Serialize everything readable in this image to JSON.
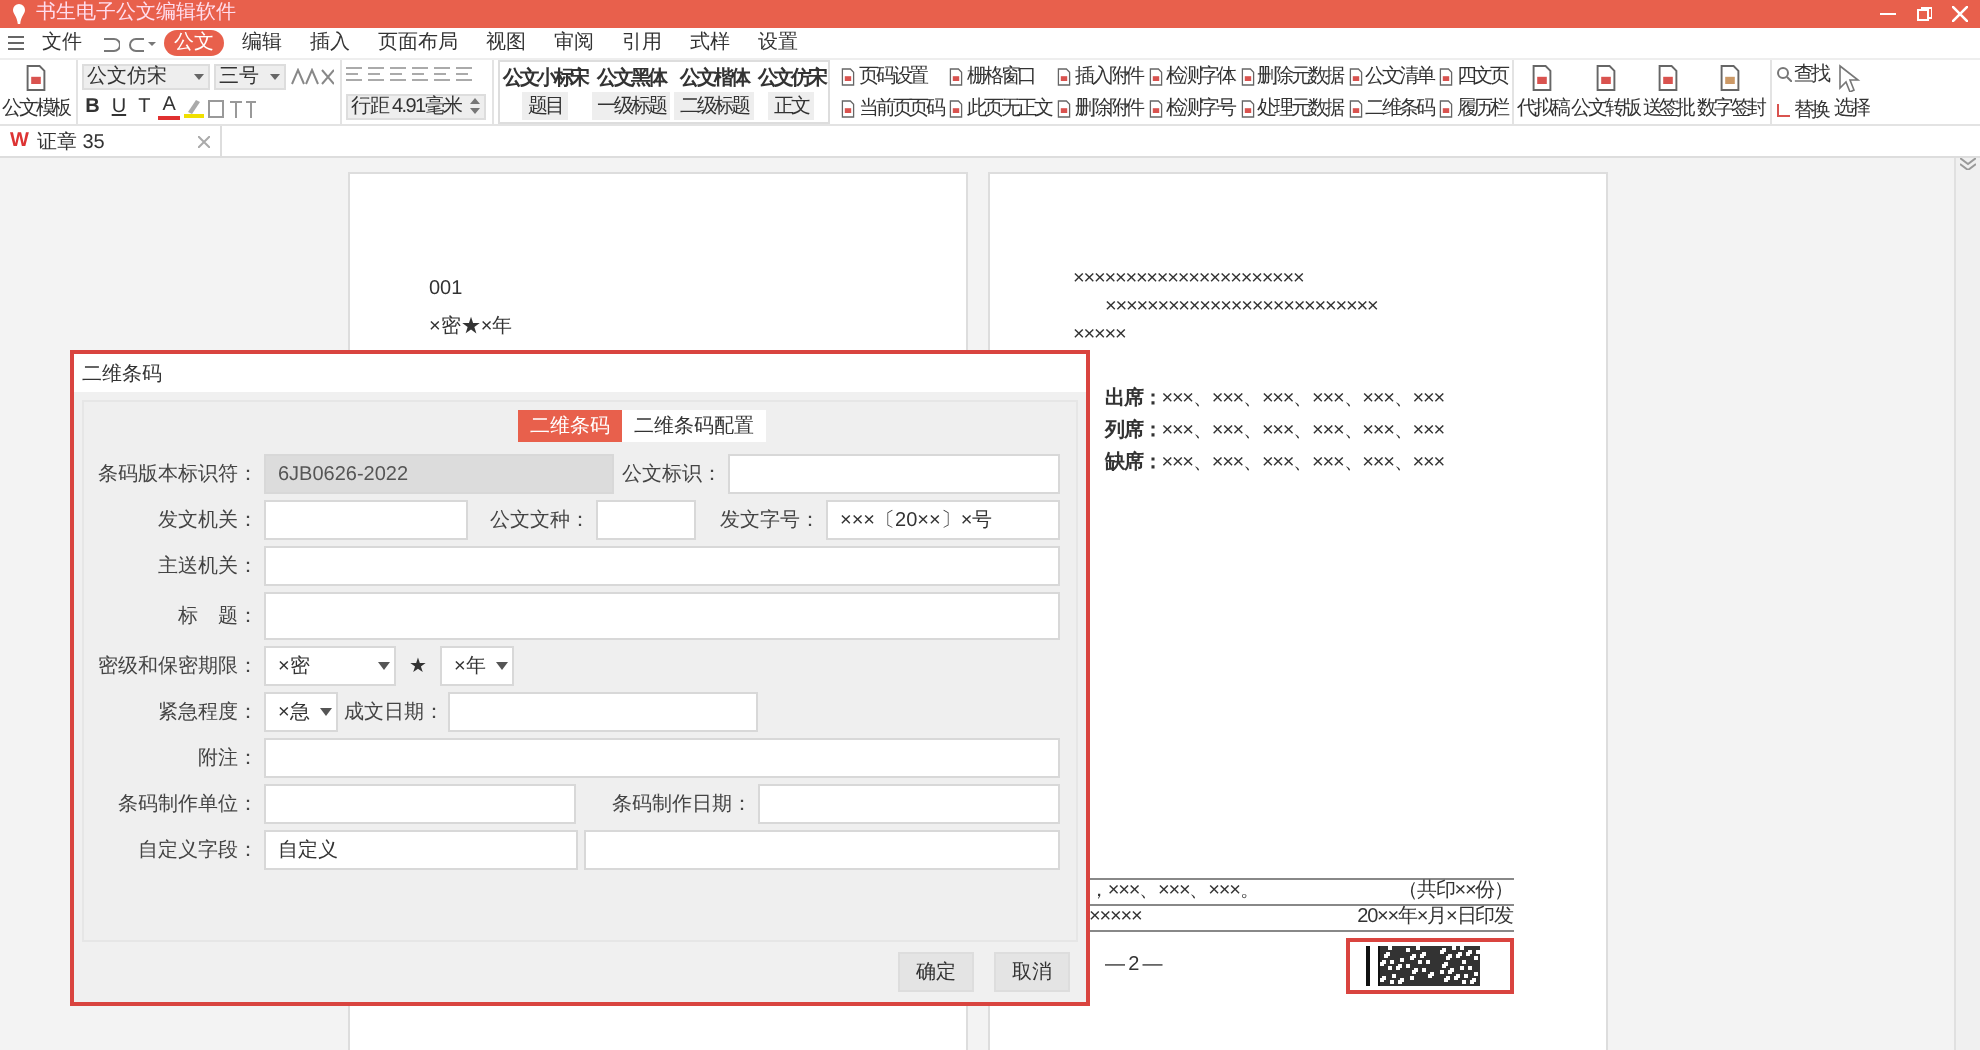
{
  "window": {
    "title": "书生电子公文编辑软件"
  },
  "menu": [
    {
      "label": "文件",
      "selected": false
    },
    {
      "label": "公文",
      "selected": true
    },
    {
      "label": "编辑",
      "selected": false
    },
    {
      "label": "插入",
      "selected": false
    },
    {
      "label": "页面布局",
      "selected": false
    },
    {
      "label": "视图",
      "selected": false
    },
    {
      "label": "审阅",
      "selected": false
    },
    {
      "label": "引用",
      "selected": false
    },
    {
      "label": "式样",
      "selected": false
    },
    {
      "label": "设置",
      "selected": false
    }
  ],
  "ribbon": {
    "template": "公文模板",
    "font": "公文仿宋",
    "font_size": "三号",
    "format_buttons": [
      {
        "text": "B",
        "kind": "bold"
      },
      {
        "text": "U",
        "kind": "underline"
      },
      {
        "text": "T",
        "kind": "plain"
      },
      {
        "text": "A",
        "kind": "color"
      }
    ],
    "line_spacing": "行距 4.91毫米",
    "styles": [
      {
        "name": "公文小标宋",
        "level": "题目"
      },
      {
        "name": "公文黑体",
        "level": "一级标题"
      },
      {
        "name": "公文楷体",
        "level": "二级标题"
      },
      {
        "name": "公文仿宋",
        "level": "正文"
      }
    ],
    "tools": [
      "页码设置",
      "当前页页码",
      "栅格窗口",
      "此页无正文",
      "插入附件",
      "删除附件",
      "检测字体",
      "检测字号",
      "删除元数据",
      "处理元数据",
      "公文清单",
      "二维条码",
      "四文页",
      "履历栏"
    ],
    "big_tools": [
      "代拟稿",
      "公文转版",
      "送签批",
      "数字签封"
    ],
    "find": [
      "查找",
      "替换",
      "选择"
    ]
  },
  "doc_tab": {
    "mark": "W",
    "title": "证章 35"
  },
  "left_page": {
    "lines": [
      "001",
      "×密★×年"
    ]
  },
  "right_page": {
    "lines": [
      "××××××××××××××××××××××",
      "××××××××××××××××××××××××××",
      "×××××"
    ],
    "attendance": [
      {
        "label": "出席：",
        "names": "×××、×××、×××、×××、×××、×××"
      },
      {
        "label": "列席：",
        "names": "×××、×××、×××、×××、×××、×××"
      },
      {
        "label": "缺席：",
        "names": "×××、×××、×××、×××、×××、×××"
      }
    ],
    "footer": [
      {
        "left": "，×××、×××、×××。",
        "right": "（共印××份）"
      },
      {
        "left": "×××××",
        "right": "20××年×月×日印发"
      }
    ],
    "page_number": "— 2 —"
  },
  "dialog": {
    "title": "二维条码",
    "tabs": [
      {
        "label": "二维条码",
        "selected": true
      },
      {
        "label": "二维条码配置",
        "selected": false
      }
    ],
    "rows": [
      {
        "items": [
          {
            "kind": "label",
            "text": "条码版本标识符："
          },
          {
            "kind": "input",
            "value": "6JB0626-2022",
            "disabled": true
          },
          {
            "kind": "label",
            "text": "公文标识："
          },
          {
            "kind": "input",
            "disabled": false
          }
        ]
      },
      {
        "items": [
          {
            "kind": "label",
            "text": "发文机关："
          },
          {
            "kind": "input",
            "disabled": false
          },
          {
            "kind": "label",
            "text": "公文文种："
          },
          {
            "kind": "input",
            "disabled": false
          },
          {
            "kind": "label",
            "text": "发文字号："
          },
          {
            "kind": "input",
            "value": "×××〔20××〕×号",
            "disabled": false
          }
        ]
      },
      {
        "items": [
          {
            "kind": "label",
            "text": "主送机关："
          },
          {
            "kind": "input",
            "disabled": false
          }
        ]
      },
      {
        "items": [
          {
            "kind": "label",
            "text": "标　题："
          },
          {
            "kind": "input",
            "disabled": false
          }
        ]
      },
      {
        "items": [
          {
            "kind": "label",
            "text": "密级和保密期限："
          },
          {
            "kind": "select",
            "value": "×密"
          },
          {
            "kind": "star",
            "text": "★"
          },
          {
            "kind": "select",
            "value": "×年"
          }
        ]
      },
      {
        "items": [
          {
            "kind": "label",
            "text": "紧急程度："
          },
          {
            "kind": "select",
            "value": "×急"
          },
          {
            "kind": "label",
            "text": "成文日期："
          },
          {
            "kind": "input",
            "disabled": false
          }
        ]
      },
      {
        "items": [
          {
            "kind": "label",
            "text": "附注："
          },
          {
            "kind": "input",
            "disabled": false
          }
        ]
      },
      {
        "items": [
          {
            "kind": "label",
            "text": "条码制作单位："
          },
          {
            "kind": "input",
            "disabled": false
          },
          {
            "kind": "label",
            "text": "条码制作日期："
          },
          {
            "kind": "input",
            "disabled": false
          }
        ]
      },
      {
        "items": [
          {
            "kind": "label",
            "text": "自定义字段："
          },
          {
            "kind": "input",
            "value": "自定义",
            "disabled": false
          },
          {
            "kind": "input",
            "disabled": false
          }
        ]
      }
    ],
    "buttons": [
      "确定",
      "取消"
    ]
  }
}
